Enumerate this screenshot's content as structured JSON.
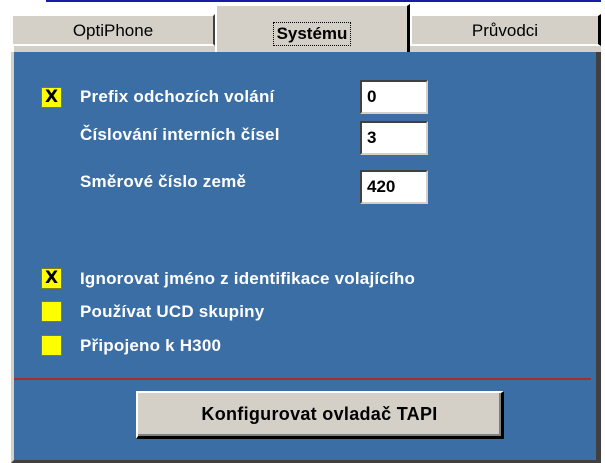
{
  "tabs": [
    {
      "label": "OptiPhone",
      "active": false
    },
    {
      "label": "Systému",
      "active": true
    },
    {
      "label": "Průvodci",
      "active": false
    }
  ],
  "settings": {
    "prefix": {
      "label": "Prefix odchozích volání",
      "checked": true,
      "value": "0"
    },
    "numbering": {
      "label": "Číslování interních čísel",
      "value": "3"
    },
    "country_code": {
      "label": "Směrové číslo země",
      "value": "420"
    }
  },
  "options": [
    {
      "label": "Ignorovat jméno z identifikace volajícího",
      "checked": true
    },
    {
      "label": "Používat UCD skupiny",
      "checked": false
    },
    {
      "label": "Připojeno k H300",
      "checked": false
    }
  ],
  "check_mark": "X",
  "configure_button": "Konfigurovat ovladač TAPI",
  "colors": {
    "panel": "#3a6ea5",
    "checkbox": "#ffff00",
    "divider": "#b0282a",
    "chrome": "#d4d0c8"
  }
}
